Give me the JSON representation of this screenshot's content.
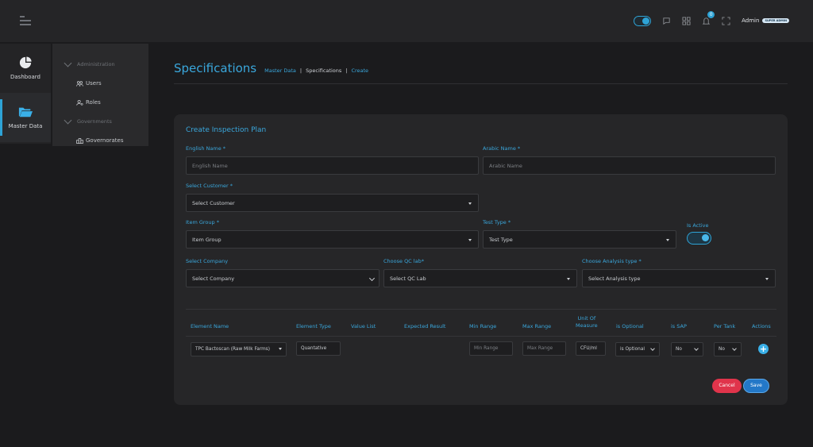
{
  "topbar": {
    "admin_label": "Admin",
    "admin_badge": "SUPER ADMIN",
    "notification_count": "0"
  },
  "rail": {
    "items": [
      {
        "label": "Dashboard",
        "icon": "pie-chart-icon",
        "active": false
      },
      {
        "label": "Master Data",
        "icon": "folder-open-icon",
        "active": true
      }
    ]
  },
  "subnav": {
    "administration": "Administration",
    "users": "Users",
    "roles": "Roles",
    "governments": "Governments",
    "governorates": "Governorates"
  },
  "page": {
    "title": "Specifications",
    "breadcrumb": [
      "Master Data",
      "|",
      "Specifications",
      "|",
      "Create"
    ]
  },
  "form": {
    "title": "Create Inspection Plan",
    "english_name_label": "English Name *",
    "english_name_placeholder": "English Name",
    "arabic_name_label": "Arabic Name *",
    "arabic_name_placeholder": "Arabic Name",
    "customer_label": "Select Customer *",
    "customer_value": "Select Customer",
    "item_group_label": "Item Group *",
    "item_group_value": "Item Group",
    "test_type_label": "Test Type *",
    "test_type_value": "Test Type",
    "is_active_label": "Is Active",
    "is_active": true,
    "company_label": "Select Company",
    "company_value": "Select Company",
    "qc_lab_label": "Choose QC lab*",
    "qc_lab_value": "Select QC Lab",
    "analysis_label": "Choose Analysis type *",
    "analysis_value": "Select Analysis type"
  },
  "table": {
    "headers": {
      "element_name": "Element Name",
      "element_type": "Element Type",
      "value_list": "Value List",
      "expected_result": "Expected Result",
      "min_range": "Min Range",
      "max_range": "Max Range",
      "unit_line1": "Unit Of",
      "unit_line2": "Measure",
      "is_optional": "is Optional",
      "is_sap": "is SAP",
      "per_tank": "Per Tank",
      "actions": "Actions"
    },
    "row": {
      "element_name": "TPC Bactoscan (Raw Milk Farms)",
      "element_type": "Quantative",
      "min_range": "Min Range",
      "max_range": "Max Range",
      "unit": "CFU/ml",
      "is_optional": "is Optional",
      "is_sap": "No",
      "per_tank": "No"
    }
  },
  "actions": {
    "cancel": "Cancel",
    "save": "Save"
  },
  "colors": {
    "accent": "#2ea3d6",
    "cancel": "#e0344b",
    "save": "#2378c8"
  }
}
